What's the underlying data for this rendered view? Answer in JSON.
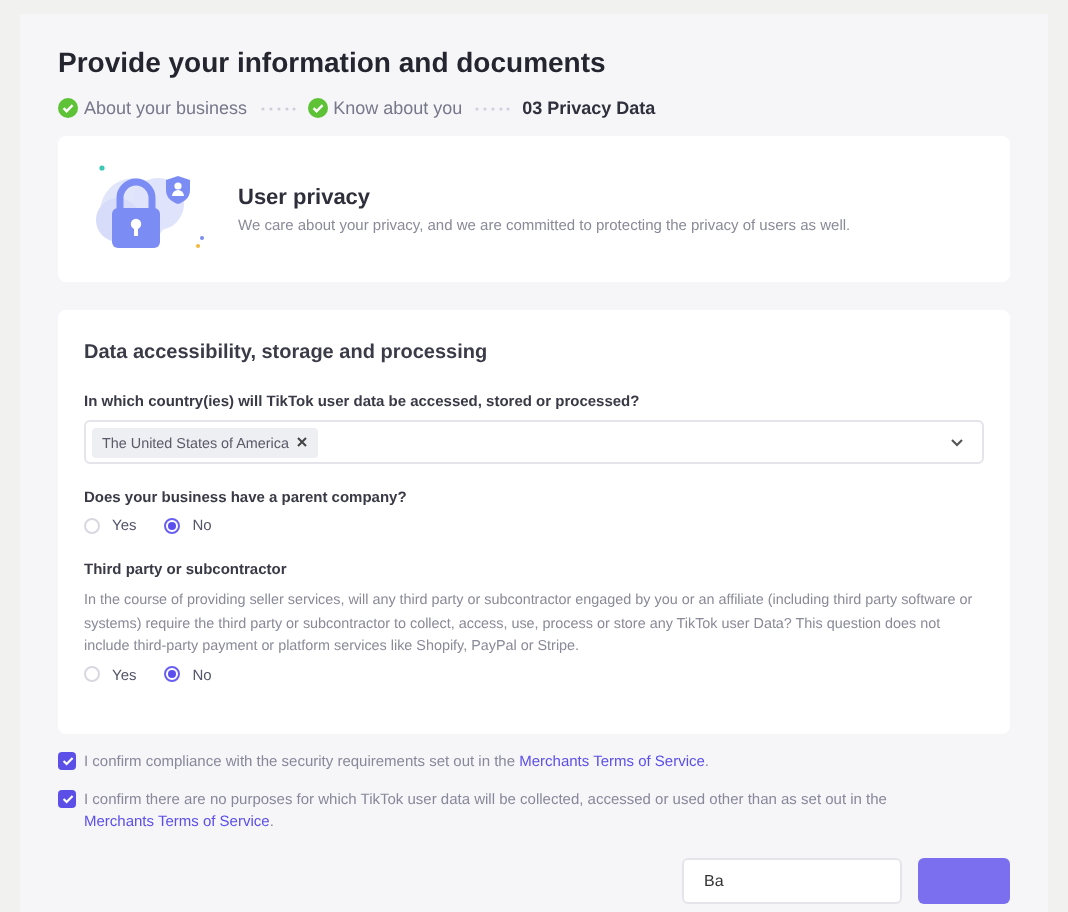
{
  "title": "Provide your information and documents",
  "steps": [
    {
      "label": "About your business",
      "done": true
    },
    {
      "label": "Know about you",
      "done": true
    },
    {
      "label": "03 Privacy Data",
      "done": false
    }
  ],
  "intro": {
    "heading": "User privacy",
    "text": "We care about your privacy, and we are committed to protecting the privacy of users as well."
  },
  "section": {
    "heading": "Data accessibility, storage and processing",
    "country": {
      "label": "In which country(ies) will TikTok user data be accessed, stored or processed?",
      "tags": [
        "The United States of America"
      ]
    },
    "questions": [
      {
        "label": "Does your business have a parent company?",
        "options": [
          {
            "label": "Yes",
            "selected": false
          },
          {
            "label": "No",
            "selected": true
          }
        ]
      },
      {
        "label": "Third party or subcontractor",
        "description": "In the course of providing seller services, will any third party or subcontractor engaged by you or an affiliate (including third party software or systems) require the third party or subcontractor to collect, access, use, process or store any TikTok user Data? This question does not include third-party payment or platform services like Shopify, PayPal or Stripe.",
        "options": [
          {
            "label": "Yes",
            "selected": false
          },
          {
            "label": "No",
            "selected": true
          }
        ]
      }
    ]
  },
  "confirmations": [
    {
      "checked": true,
      "text": "I confirm compliance with the security requirements set out in the ",
      "link": "Merchants Terms of Service",
      "after": "."
    },
    {
      "checked": true,
      "text": "I confirm there are no purposes for which TikTok user data will be collected, accessed or used other than as set out in the ",
      "link": "Merchants Terms of Service",
      "after": "."
    }
  ],
  "buttons": [
    {
      "kind": "secondary",
      "label": "Ba"
    },
    {
      "kind": "primary"
    }
  ]
}
